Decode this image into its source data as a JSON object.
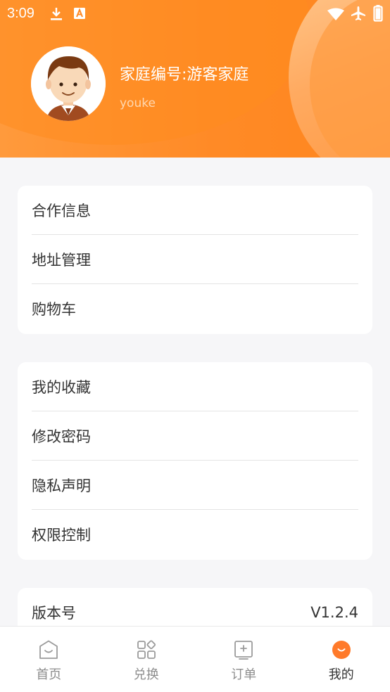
{
  "status_bar": {
    "time": "3:09"
  },
  "profile": {
    "family_title": "家庭编号:游客家庭",
    "username": "youke"
  },
  "menu_group_1": [
    {
      "label": "合作信息"
    },
    {
      "label": "地址管理"
    },
    {
      "label": "购物车"
    }
  ],
  "menu_group_2": [
    {
      "label": "我的收藏"
    },
    {
      "label": "修改密码"
    },
    {
      "label": "隐私声明"
    },
    {
      "label": "权限控制"
    }
  ],
  "version": {
    "label": "版本号",
    "value": "V1.2.4"
  },
  "tabbar": [
    {
      "label": "首页",
      "icon": "home-icon",
      "active": false
    },
    {
      "label": "兑换",
      "icon": "exchange-icon",
      "active": false
    },
    {
      "label": "订单",
      "icon": "orders-icon",
      "active": false
    },
    {
      "label": "我的",
      "icon": "profile-icon",
      "active": true
    }
  ],
  "colors": {
    "accent": "#ff8a26",
    "background": "#f6f6f8"
  }
}
